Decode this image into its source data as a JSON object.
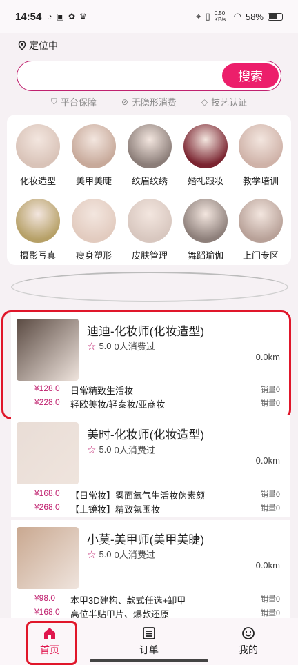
{
  "status_bar": {
    "time": "14:54",
    "net_speed": "0.50 KB/s",
    "battery": "58%"
  },
  "location": {
    "label": "定位中"
  },
  "search": {
    "placeholder": "",
    "button_label": "搜索"
  },
  "guarantees": [
    "平台保障",
    "无隐形消费",
    "技艺认证"
  ],
  "categories": [
    {
      "label": "化妆造型",
      "color": "#d9c3b8"
    },
    {
      "label": "美甲美睫",
      "color": "#c7a99a"
    },
    {
      "label": "纹眉纹绣",
      "color": "#8b7d78"
    },
    {
      "label": "婚礼跟妆",
      "color": "#7a2430"
    },
    {
      "label": "教学培训",
      "color": "#cfb2a8"
    },
    {
      "label": "摄影写真",
      "color": "#b6a067"
    },
    {
      "label": "瘦身塑形",
      "color": "#e2cbbf"
    },
    {
      "label": "皮肤管理",
      "color": "#d8c7bf"
    },
    {
      "label": "舞蹈瑜伽",
      "color": "#8d7f7a"
    },
    {
      "label": "上门专区",
      "color": "#b8a198"
    }
  ],
  "listings": [
    {
      "title": "迪迪-化妆师(化妆造型)",
      "rating": "5.0",
      "consumed": "0人消费过",
      "distance": "0.0km",
      "thumb_color": "#5a4a42",
      "services": [
        {
          "price": "¥128.0",
          "name": "日常精致生活妆",
          "sold": "销量0"
        },
        {
          "price": "¥228.0",
          "name": "轻欧美妆/轻泰妆/亚商妆",
          "sold": "销量0"
        }
      ]
    },
    {
      "title": "美时-化妆师(化妆造型)",
      "rating": "5.0",
      "consumed": "0人消费过",
      "distance": "0.0km",
      "thumb_color": "#e9ddd6",
      "services": [
        {
          "price": "¥168.0",
          "name": "【日常妆】雾面氧气生活妆伪素颜",
          "sold": "销量0"
        },
        {
          "price": "¥268.0",
          "name": "【上镜妆】精致氛围妆",
          "sold": "销量0"
        }
      ]
    },
    {
      "title": "小莫-美甲师(美甲美睫)",
      "rating": "5.0",
      "consumed": "0人消费过",
      "distance": "0.0km",
      "thumb_color": "#c9a890",
      "services": [
        {
          "price": "¥98.0",
          "name": "本甲3D建构、款式任选+卸甲",
          "sold": "销量0"
        },
        {
          "price": "¥168.0",
          "name": "高位半贴甲片、爆款还原",
          "sold": "销量0"
        }
      ]
    }
  ],
  "tabbar": {
    "home": "首页",
    "orders": "订单",
    "mine": "我的"
  },
  "colors": {
    "accent": "#ec1f6b",
    "price": "#c0216f",
    "highlight": "#e0162a"
  }
}
